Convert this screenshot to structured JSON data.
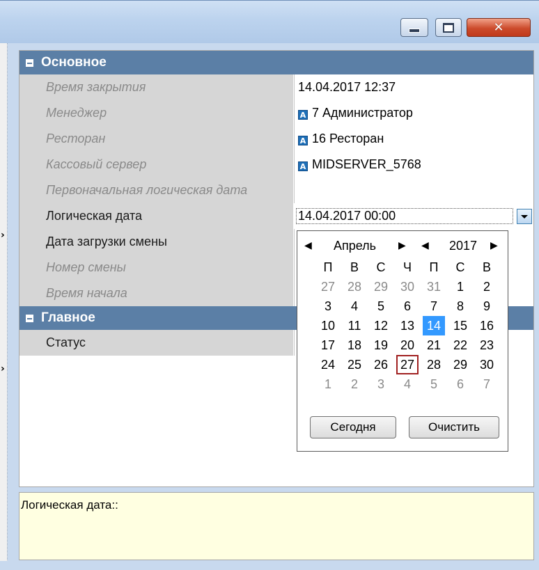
{
  "window": {
    "min_icon": "minimize-icon",
    "max_icon": "maximize-icon",
    "close_icon": "close-icon",
    "close_glyph": "✕"
  },
  "sections": [
    {
      "title": "Основное",
      "rows": [
        {
          "label": "Время закрытия",
          "value": "14.04.2017 12:37",
          "readonly": true,
          "icon": false
        },
        {
          "label": "Менеджер",
          "value": "7 Администратор",
          "readonly": true,
          "icon": true
        },
        {
          "label": "Ресторан",
          "value": "16 Ресторан",
          "readonly": true,
          "icon": true
        },
        {
          "label": "Кассовый сервер",
          "value": "MIDSERVER_5768",
          "readonly": true,
          "icon": true
        },
        {
          "label": "Первоначальная логическая дата",
          "value": "",
          "readonly": true,
          "icon": false
        },
        {
          "label": "Логическая дата",
          "value": "14.04.2017 00:00",
          "readonly": false,
          "icon": false,
          "editing": true
        },
        {
          "label": "Дата загрузки смены",
          "value": "",
          "readonly": false,
          "icon": false
        },
        {
          "label": "Номер смены",
          "value": "",
          "readonly": true,
          "icon": false
        },
        {
          "label": "Время начала",
          "value": "",
          "readonly": true,
          "icon": false
        }
      ]
    },
    {
      "title": "Главное",
      "rows": [
        {
          "label": "Статус",
          "value": "",
          "readonly": false,
          "icon": false
        }
      ]
    }
  ],
  "property_icon_letter": "A",
  "calendar": {
    "month": "Апрель",
    "year": "2017",
    "prev_glyph": "◀",
    "next_glyph": "▶",
    "weekdays": [
      "П",
      "В",
      "С",
      "Ч",
      "П",
      "С",
      "В"
    ],
    "weeks": [
      [
        "27",
        "28",
        "29",
        "30",
        "31",
        "1",
        "2"
      ],
      [
        "3",
        "4",
        "5",
        "6",
        "7",
        "8",
        "9"
      ],
      [
        "10",
        "11",
        "12",
        "13",
        "14",
        "15",
        "16"
      ],
      [
        "17",
        "18",
        "19",
        "20",
        "21",
        "22",
        "23"
      ],
      [
        "24",
        "25",
        "26",
        "27",
        "28",
        "29",
        "30"
      ],
      [
        "1",
        "2",
        "3",
        "4",
        "5",
        "6",
        "7"
      ]
    ],
    "dim_cells": [
      [
        0,
        0
      ],
      [
        0,
        1
      ],
      [
        0,
        2
      ],
      [
        0,
        3
      ],
      [
        0,
        4
      ],
      [
        5,
        0
      ],
      [
        5,
        1
      ],
      [
        5,
        2
      ],
      [
        5,
        3
      ],
      [
        5,
        4
      ],
      [
        5,
        5
      ],
      [
        5,
        6
      ]
    ],
    "selected_cell": [
      2,
      4
    ],
    "today_cell": [
      4,
      3
    ],
    "today_button": "Сегодня",
    "clear_button": "Очистить"
  },
  "help_text": "Логическая дата::",
  "expand_arrow": "›"
}
